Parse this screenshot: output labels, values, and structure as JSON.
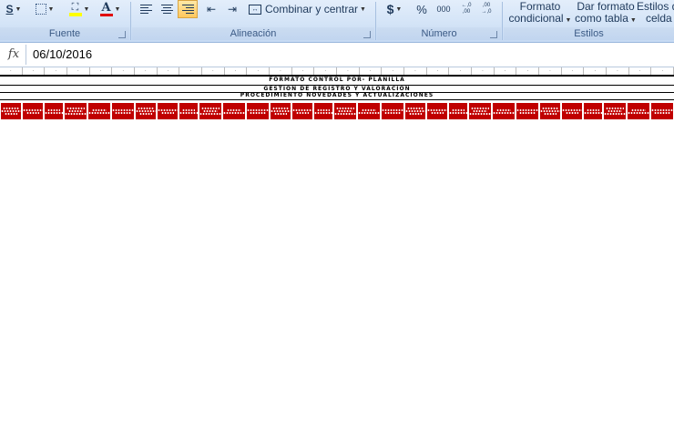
{
  "ribbon": {
    "groups": {
      "fuente": "Fuente",
      "alineacion": "Alineación",
      "numero": "Número",
      "estilos": "Estilos"
    },
    "font_underline": "S",
    "font_color_glyph": "A",
    "merge_center": "Combinar y centrar",
    "currency": "$",
    "percent": "%",
    "thousands": "000",
    "decimals_increase": "←,0 ,00",
    "decimals_decrease": ",00 →,0",
    "cond_format_line1": "Formato",
    "cond_format_line2": "condicional",
    "table_format_line1": "Dar formato",
    "table_format_line2": "como tabla",
    "cell_styles_line1": "Estilos de",
    "cell_styles_line2": "celda",
    "colors": {
      "fill_highlight": "#ffff00",
      "font_red": "#e00000",
      "ribbon_bg": "#d4e4f7"
    }
  },
  "formula_bar": {
    "fx": "fx",
    "value": "06/10/2016"
  },
  "sheet": {
    "title_1": "FORMATO CONTROL POR- PLANILLA",
    "title_2": "GESTION DE REGISTRO Y VALORACION",
    "title_3": "PROCEDIMIENTO NOVEDADES Y ACTUALIZACIONES",
    "header_fill": "#c00000",
    "column_count": 30
  }
}
